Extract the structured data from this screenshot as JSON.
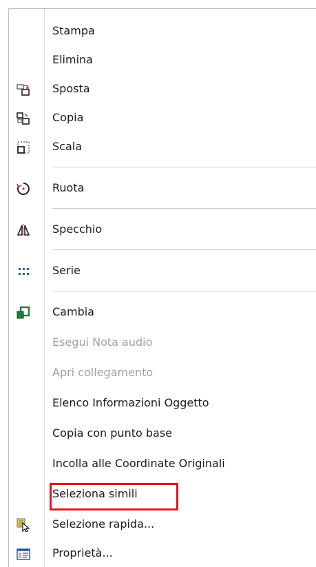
{
  "menu": {
    "items": [
      {
        "label": "Stampa",
        "icon": null,
        "enabled": true
      },
      {
        "label": "Elimina",
        "icon": null,
        "enabled": true
      },
      {
        "label": "Sposta",
        "icon": "move-icon",
        "enabled": true
      },
      {
        "label": "Copia",
        "icon": "copy-icon",
        "enabled": true
      },
      {
        "label": "Scala",
        "icon": "scale-icon",
        "enabled": true
      },
      {
        "label": "Ruota",
        "icon": "rotate-icon",
        "enabled": true
      },
      {
        "label": "Specchio",
        "icon": "mirror-icon",
        "enabled": true
      },
      {
        "label": "Serie",
        "icon": "array-icon",
        "enabled": true
      },
      {
        "label": "Cambia",
        "icon": "change-icon",
        "enabled": true
      },
      {
        "label": "Esegui Nota audio",
        "icon": null,
        "enabled": false
      },
      {
        "label": "Apri collegamento",
        "icon": null,
        "enabled": false
      },
      {
        "label": "Elenco Informazioni Oggetto",
        "icon": null,
        "enabled": true
      },
      {
        "label": "Copia con punto base",
        "icon": null,
        "enabled": true
      },
      {
        "label": "Incolla alle Coordinate Originali",
        "icon": null,
        "enabled": true
      },
      {
        "label": "Seleziona simili",
        "icon": null,
        "enabled": true,
        "highlighted": true
      },
      {
        "label": "Selezione rapida...",
        "icon": "quick-select-icon",
        "enabled": true
      },
      {
        "label": "Proprietà...",
        "icon": "properties-icon",
        "enabled": true
      }
    ]
  },
  "colors": {
    "highlight_border": "#e8141b",
    "disabled_text": "#a0a0a0",
    "icon_blue": "#2f5fa8",
    "icon_green": "#1e7d3a"
  }
}
